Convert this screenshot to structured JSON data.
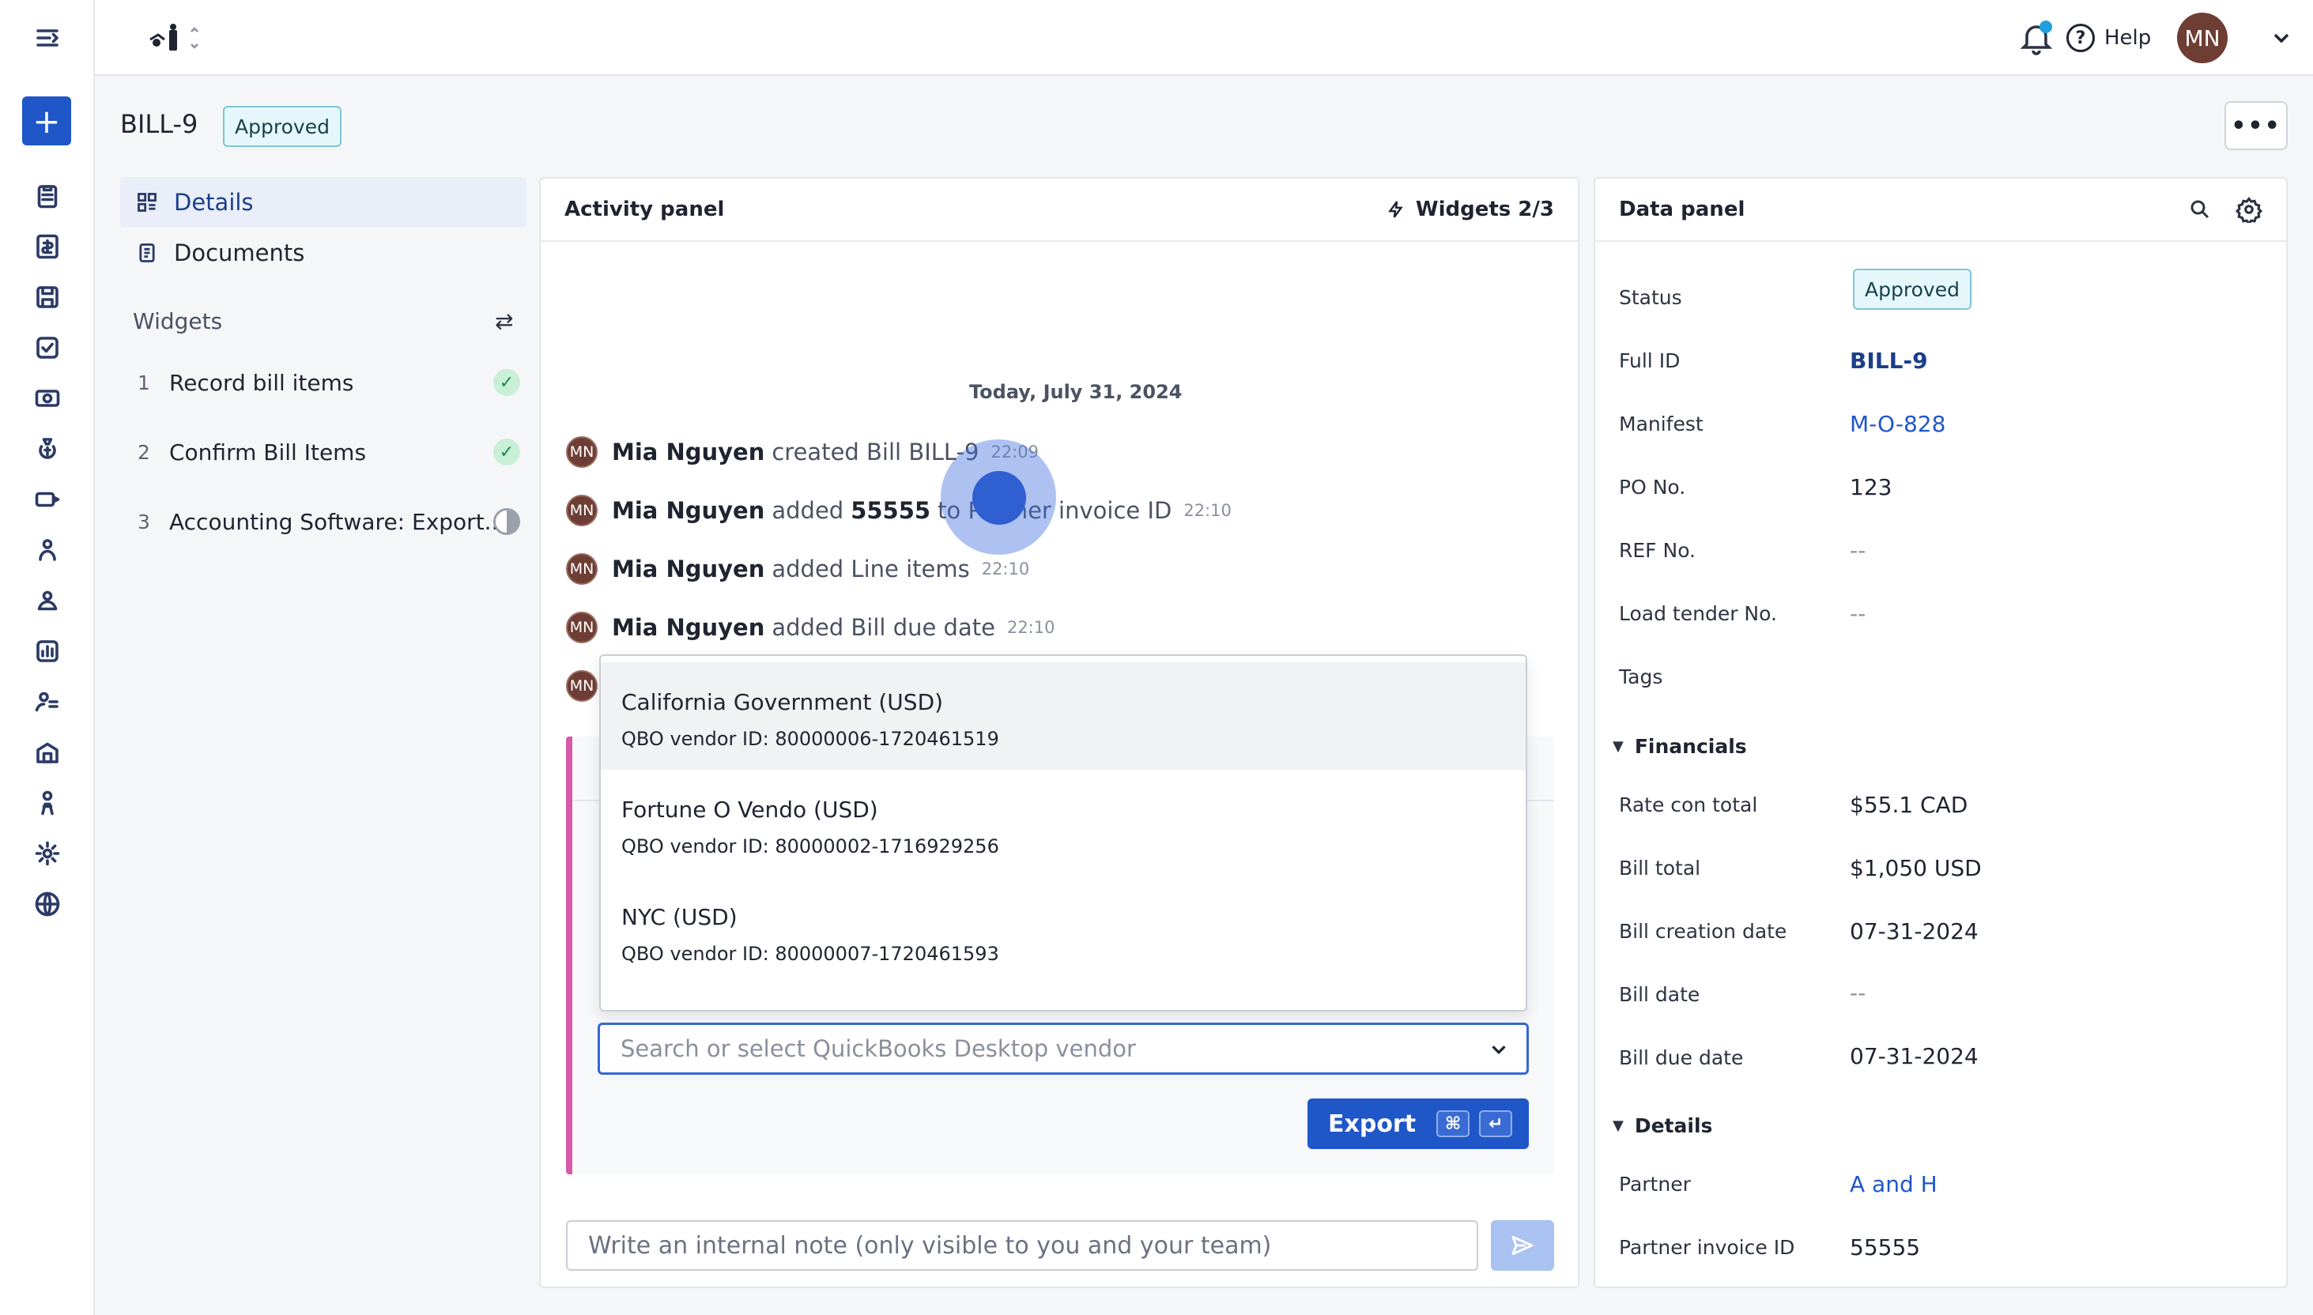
{
  "header": {
    "notification_dot_color": "#1f9fe0",
    "help_label": "Help",
    "user_initials": "MN"
  },
  "page": {
    "title": "BILL-9",
    "status_badge": "Approved"
  },
  "left_nav": {
    "details_label": "Details",
    "documents_label": "Documents",
    "widgets_heading": "Widgets",
    "widgets": [
      {
        "num": "1",
        "label": "Record bill items",
        "state": "done"
      },
      {
        "num": "2",
        "label": "Confirm Bill Items",
        "state": "done"
      },
      {
        "num": "3",
        "label": "Accounting Software: Export...",
        "state": "in-progress"
      }
    ]
  },
  "activity": {
    "panel_title": "Activity panel",
    "widgets_label": "Widgets 2/3",
    "date_divider": "Today, July 31, 2024",
    "entries": [
      {
        "initials": "MN",
        "user": "Mia Nguyen",
        "text": "created Bill BILL-9",
        "bold": "",
        "after": "",
        "time": "22:09"
      },
      {
        "initials": "MN",
        "user": "Mia Nguyen",
        "text": "added",
        "bold": "55555",
        "after": "to Partner invoice ID",
        "time": "22:10"
      },
      {
        "initials": "MN",
        "user": "Mia Nguyen",
        "text": "added Line items",
        "bold": "",
        "after": "",
        "time": "22:10"
      },
      {
        "initials": "MN",
        "user": "Mia Nguyen",
        "text": "added Bill due date",
        "bold": "",
        "after": "",
        "time": "22:10"
      },
      {
        "initials": "MN"
      }
    ],
    "vendor_options": [
      {
        "name": "California Government (USD)",
        "sub": "QBO vendor ID: 80000006-1720461519"
      },
      {
        "name": "Fortune O Vendo (USD)",
        "sub": "QBO vendor ID: 80000002-1716929256"
      },
      {
        "name": "NYC (USD)",
        "sub": "QBO vendor ID: 80000007-1720461593"
      }
    ],
    "vendor_placeholder": "Search or select QuickBooks Desktop vendor",
    "export_label": "Export",
    "export_kbd_1": "⌘",
    "export_kbd_2": "↵",
    "note_placeholder": "Write an internal note (only visible to you and your team)"
  },
  "data_panel": {
    "title": "Data panel",
    "fields": {
      "status_label": "Status",
      "status_value": "Approved",
      "full_id_label": "Full ID",
      "full_id_value": "BILL-9",
      "manifest_label": "Manifest",
      "manifest_value": "M-O-828",
      "po_label": "PO No.",
      "po_value": "123",
      "ref_label": "REF No.",
      "ref_value": "--",
      "load_label": "Load tender No.",
      "load_value": "--",
      "tags_label": "Tags"
    },
    "financials": {
      "heading": "Financials",
      "rate_con_label": "Rate con total",
      "rate_con_value": "$55.1 CAD",
      "bill_total_label": "Bill total",
      "bill_total_value": "$1,050 USD",
      "creation_label": "Bill creation date",
      "creation_value": "07-31-2024",
      "bill_date_label": "Bill date",
      "bill_date_value": "--",
      "due_label": "Bill due date",
      "due_value": "07-31-2024"
    },
    "details": {
      "heading": "Details",
      "partner_label": "Partner",
      "partner_value": "A and H",
      "invoice_label": "Partner invoice ID",
      "invoice_value": "55555"
    }
  }
}
